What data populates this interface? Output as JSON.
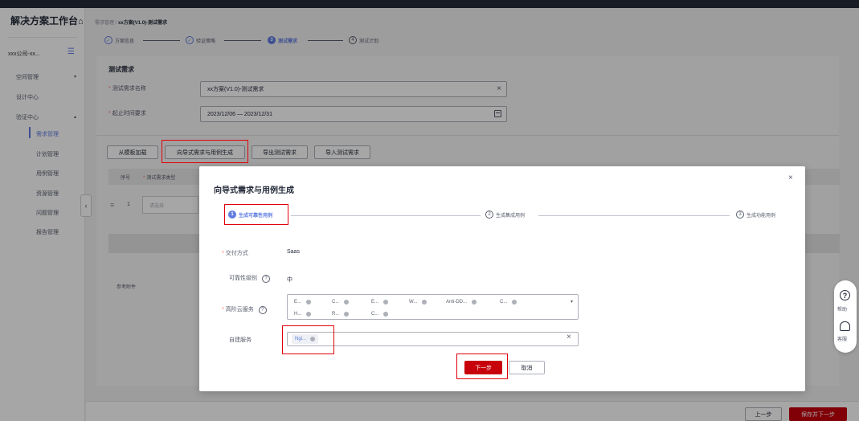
{
  "sidebar": {
    "brand": "解决方案工作台",
    "company": "xxx公司-xx...",
    "nav": [
      {
        "label": "空间管理",
        "caret": "▾"
      },
      {
        "label": "设计中心"
      },
      {
        "label": "验证中心",
        "caret": "▴"
      }
    ],
    "subnav": [
      "需求管理",
      "计划管理",
      "用例管理",
      "资源管理",
      "问题管理",
      "报告管理"
    ]
  },
  "breadcrumb": {
    "parent": "需求管理 / ",
    "current": "xx方案(V1.0)-测试需求"
  },
  "steps": [
    {
      "label": "方案信息",
      "icon": "✓"
    },
    {
      "label": "验证策略",
      "icon": "✓"
    },
    {
      "label": "测试需求",
      "icon": "3"
    },
    {
      "label": "测试计划",
      "icon": "4"
    }
  ],
  "form": {
    "section_title": "测试需求",
    "name_label": "测试需求名称",
    "name_value": "xx方案(V1.0)-测试需求",
    "date_label": "起止时间要求",
    "date_value": "2023/12/06 — 2023/12/31"
  },
  "toolbar": {
    "from_template": "从模板加载",
    "wizard": "向导式需求与用例生成",
    "export": "导出测试需求",
    "import": "导入测试需求"
  },
  "table": {
    "col_index": "序号",
    "col_type": "测试需求类型",
    "row_index": "1",
    "row_select_placeholder": "请选择"
  },
  "attachments_label": "参考附件",
  "footer": {
    "prev": "上一步",
    "save_next": "保存并下一步"
  },
  "float": {
    "help": "帮助",
    "service": "客服"
  },
  "modal": {
    "title": "向导式需求与用例生成",
    "close": "×",
    "steps": [
      {
        "num": "1",
        "label": "生成可靠性用例"
      },
      {
        "num": "2",
        "label": "生成集成用例"
      },
      {
        "num": "3",
        "label": "生成功能用例"
      }
    ],
    "delivery_label": "交付方式",
    "delivery_value": "Saas",
    "reliability_label": "可靠性级别",
    "reliability_value": "中",
    "cloud_label": "高阶云服务",
    "cloud_tags_row1": [
      "E...",
      "C...",
      "E...",
      "W...",
      "Anti-DD...",
      "C..."
    ],
    "cloud_tags_row2": [
      "H...",
      "R...",
      "C..."
    ],
    "self_label": "自建服务",
    "self_tag": "Ngi...",
    "next": "下一步",
    "cancel": "取消"
  },
  "colors": {
    "accent": "#5e7ce0",
    "primary_red": "#c7000b",
    "highlight": "#e0000b"
  }
}
